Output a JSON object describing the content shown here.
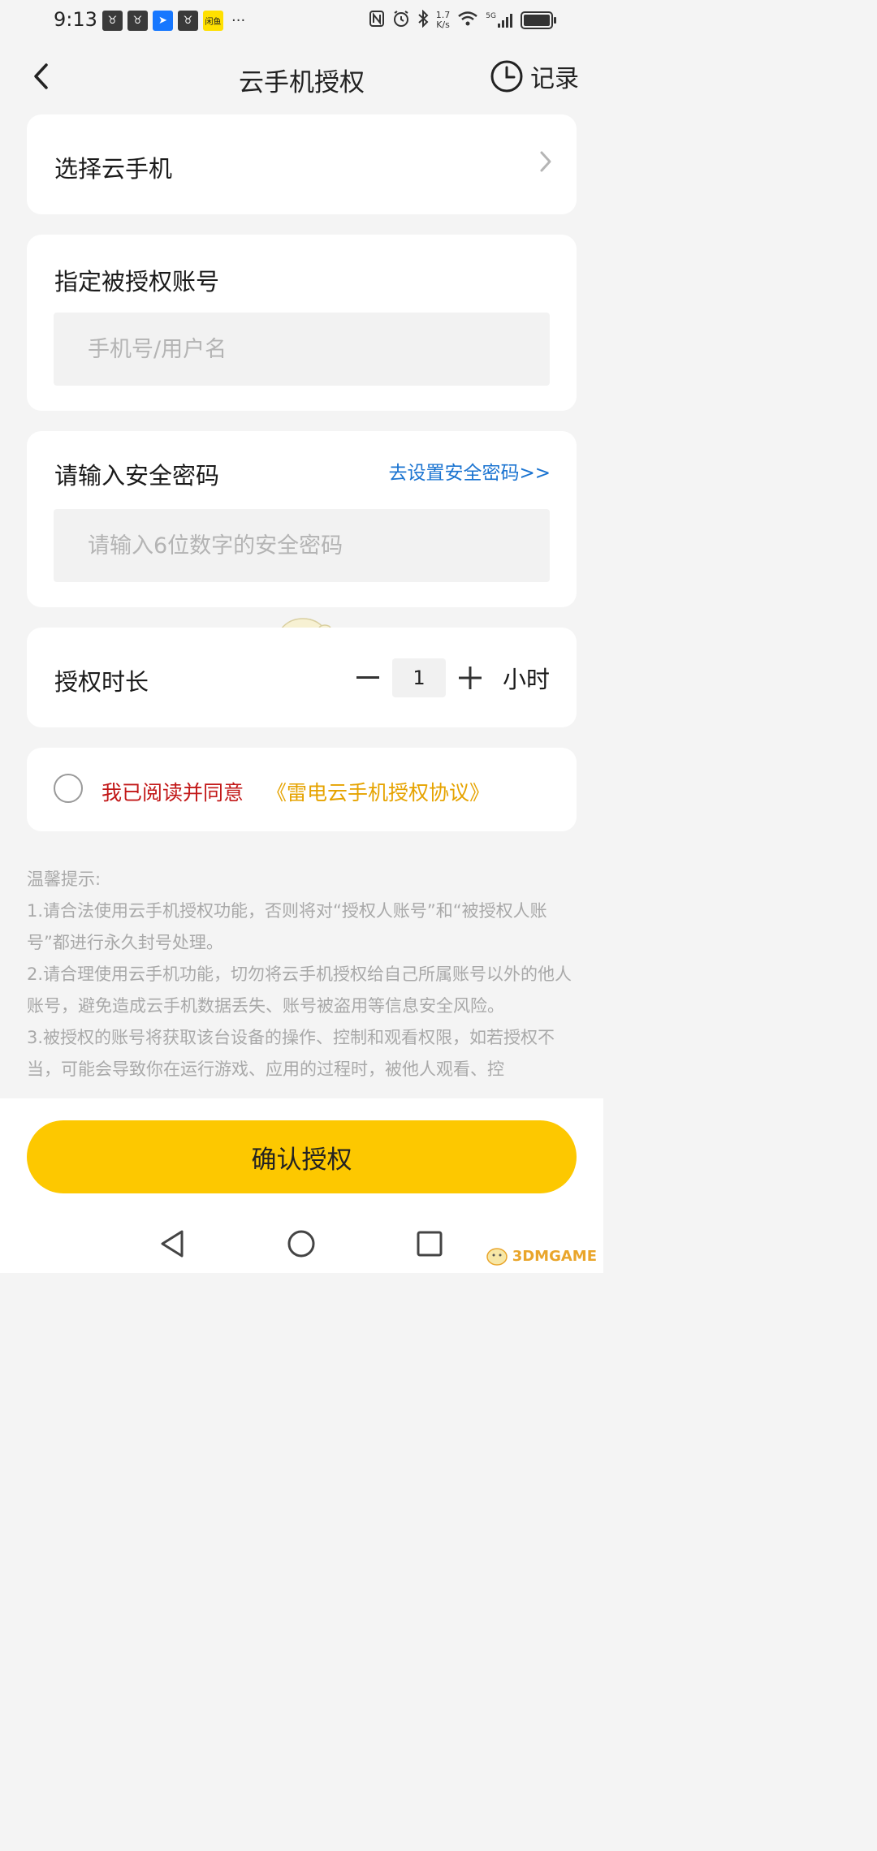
{
  "status_bar": {
    "time": "9:13",
    "more": "···",
    "app_badge": "闲鱼",
    "net_speed_value": "1.7",
    "net_speed_unit": "K/s",
    "network": "5G"
  },
  "header": {
    "title": "云手机授权",
    "record_label": "记录"
  },
  "select_card": {
    "label": "选择云手机"
  },
  "account_card": {
    "label": "指定被授权账号",
    "placeholder": "手机号/用户名",
    "value": ""
  },
  "password_card": {
    "label": "请输入安全密码",
    "link": "去设置安全密码>>",
    "placeholder": "请输入6位数字的安全密码",
    "value": ""
  },
  "duration_card": {
    "label": "授权时长",
    "value": "1",
    "unit": "小时"
  },
  "agreement": {
    "checked": false,
    "text": "我已阅读并同意",
    "link": "《雷电云手机授权协议》"
  },
  "tips": {
    "title": "温馨提示:",
    "lines": [
      "1.请合法使用云手机授权功能，否则将对“授权人账号”和“被授权人账号”都进行永久封号处理。",
      "2.请合理使用云手机功能，切勿将云手机授权给自己所属账号以外的他人账号，避免造成云手机数据丢失、账号被盗用等信息安全风险。",
      "3.被授权的账号将获取该台设备的操作、控制和观看权限，如若授权不当，可能会导致你在运行游戏、应用的过程时，被他人观看、控"
    ]
  },
  "confirm_button": "确认授权",
  "watermark": "3DMGAME",
  "colors": {
    "accent": "#fdc800",
    "link_blue": "#1b74d1",
    "agree_red": "#c21818",
    "agree_link": "#e6a300"
  }
}
